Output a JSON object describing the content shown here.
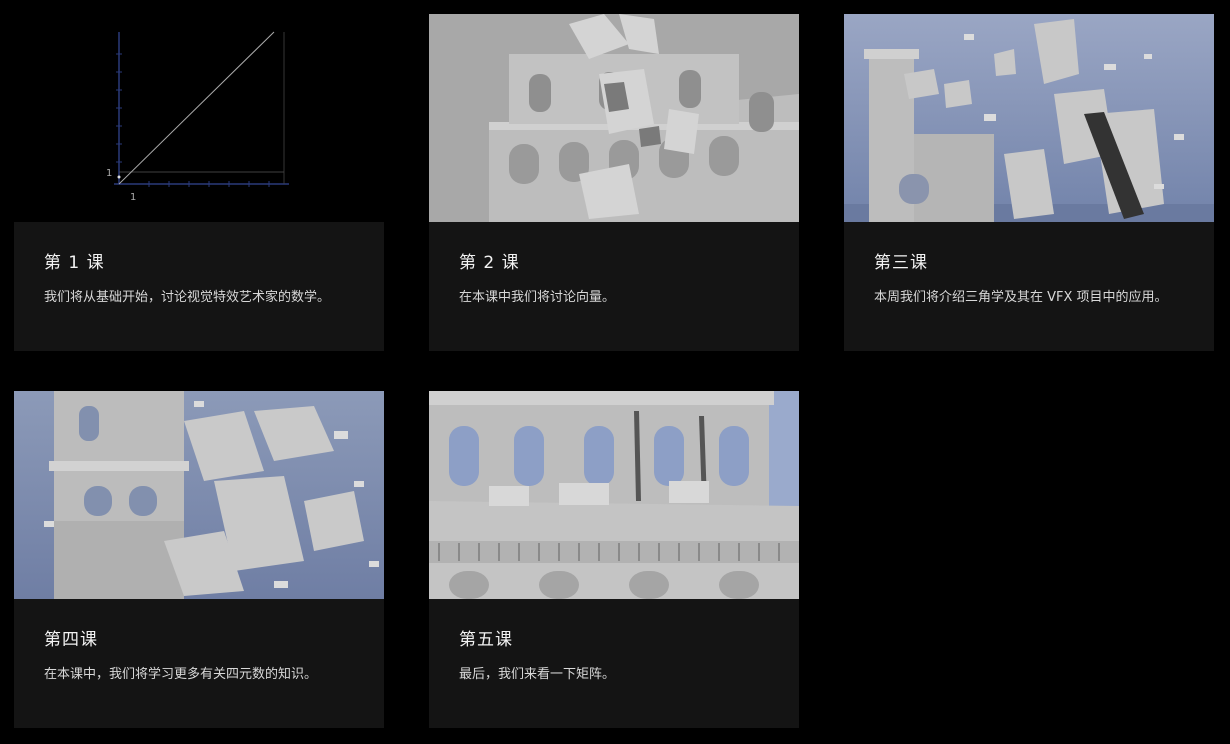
{
  "lessons": [
    {
      "title": "第 1 课",
      "description": "我们将从基础开始，讨论视觉特效艺术家的数学。",
      "thumbnail": "graph-plot-thumbnail",
      "graph_tick_x": "1",
      "graph_tick_y": "1"
    },
    {
      "title": "第 2 课",
      "description": "在本课中我们将讨论向量。",
      "thumbnail": "building-destruction-thumbnail"
    },
    {
      "title": "第三课",
      "description": "本周我们将介绍三角学及其在 VFX 项目中的应用。",
      "thumbnail": "building-destruction-thumbnail"
    },
    {
      "title": "第四课",
      "description": "在本课中，我们将学习更多有关四元数的知识。",
      "thumbnail": "building-destruction-thumbnail"
    },
    {
      "title": "第五课",
      "description": "最后，我们来看一下矩阵。",
      "thumbnail": "arcade-wall-thumbnail"
    }
  ],
  "colors": {
    "background": "#000000",
    "card": "#141414",
    "sky": "#8c9ab8",
    "stone": "#b8b8b8"
  }
}
